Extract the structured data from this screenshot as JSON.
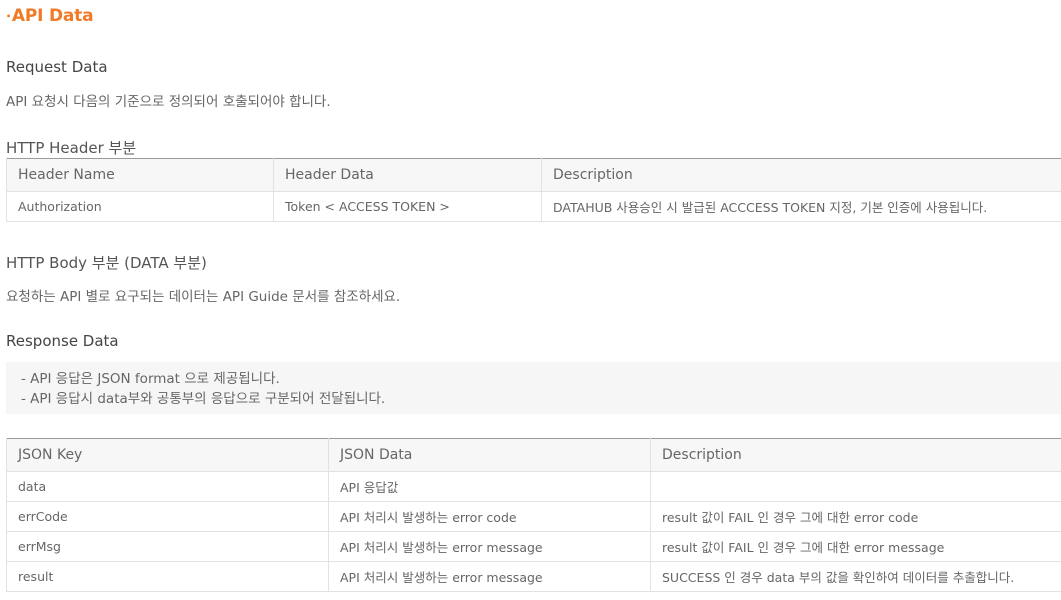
{
  "page": {
    "title": "API Data"
  },
  "request": {
    "heading": "Request Data",
    "intro": "API 요청시 다음의 기준으로 정의되어 호출되어야 합니다."
  },
  "http_header": {
    "heading": "HTTP Header 부분",
    "columns": [
      "Header Name",
      "Header Data",
      "Description"
    ],
    "rows": [
      [
        "Authorization",
        "Token < ACCESS TOKEN >",
        "DATAHUB 사용승인 시 발급된 ACCCESS TOKEN 지정, 기본 인증에 사용됩니다."
      ]
    ]
  },
  "http_body": {
    "heading": "HTTP Body 부분 (DATA 부분)",
    "intro": "요청하는 API 별로 요구되는 데이터는 API Guide 문서를 참조하세요."
  },
  "response": {
    "heading": "Response Data",
    "notes": [
      "- API 응답은 JSON format 으로 제공됩니다.",
      "- API 응답시 data부와 공통부의 응답으로 구분되어 전달됩니다."
    ],
    "columns": [
      "JSON Key",
      "JSON Data",
      "Description"
    ],
    "rows": [
      [
        "data",
        "API 응답값",
        ""
      ],
      [
        "errCode",
        "API 처리시 발생하는 error code",
        "result 값이 FAIL 인 경우 그에 대한 error code"
      ],
      [
        "errMsg",
        "API 처리시 발생하는 error message",
        "result 값이 FAIL 인 경우 그에 대한 error message"
      ],
      [
        "result",
        "API 처리시 발생하는 error message",
        "SUCCESS 인 경우 data 부의 값을 확인하여 데이터를 추출합니다."
      ]
    ]
  }
}
